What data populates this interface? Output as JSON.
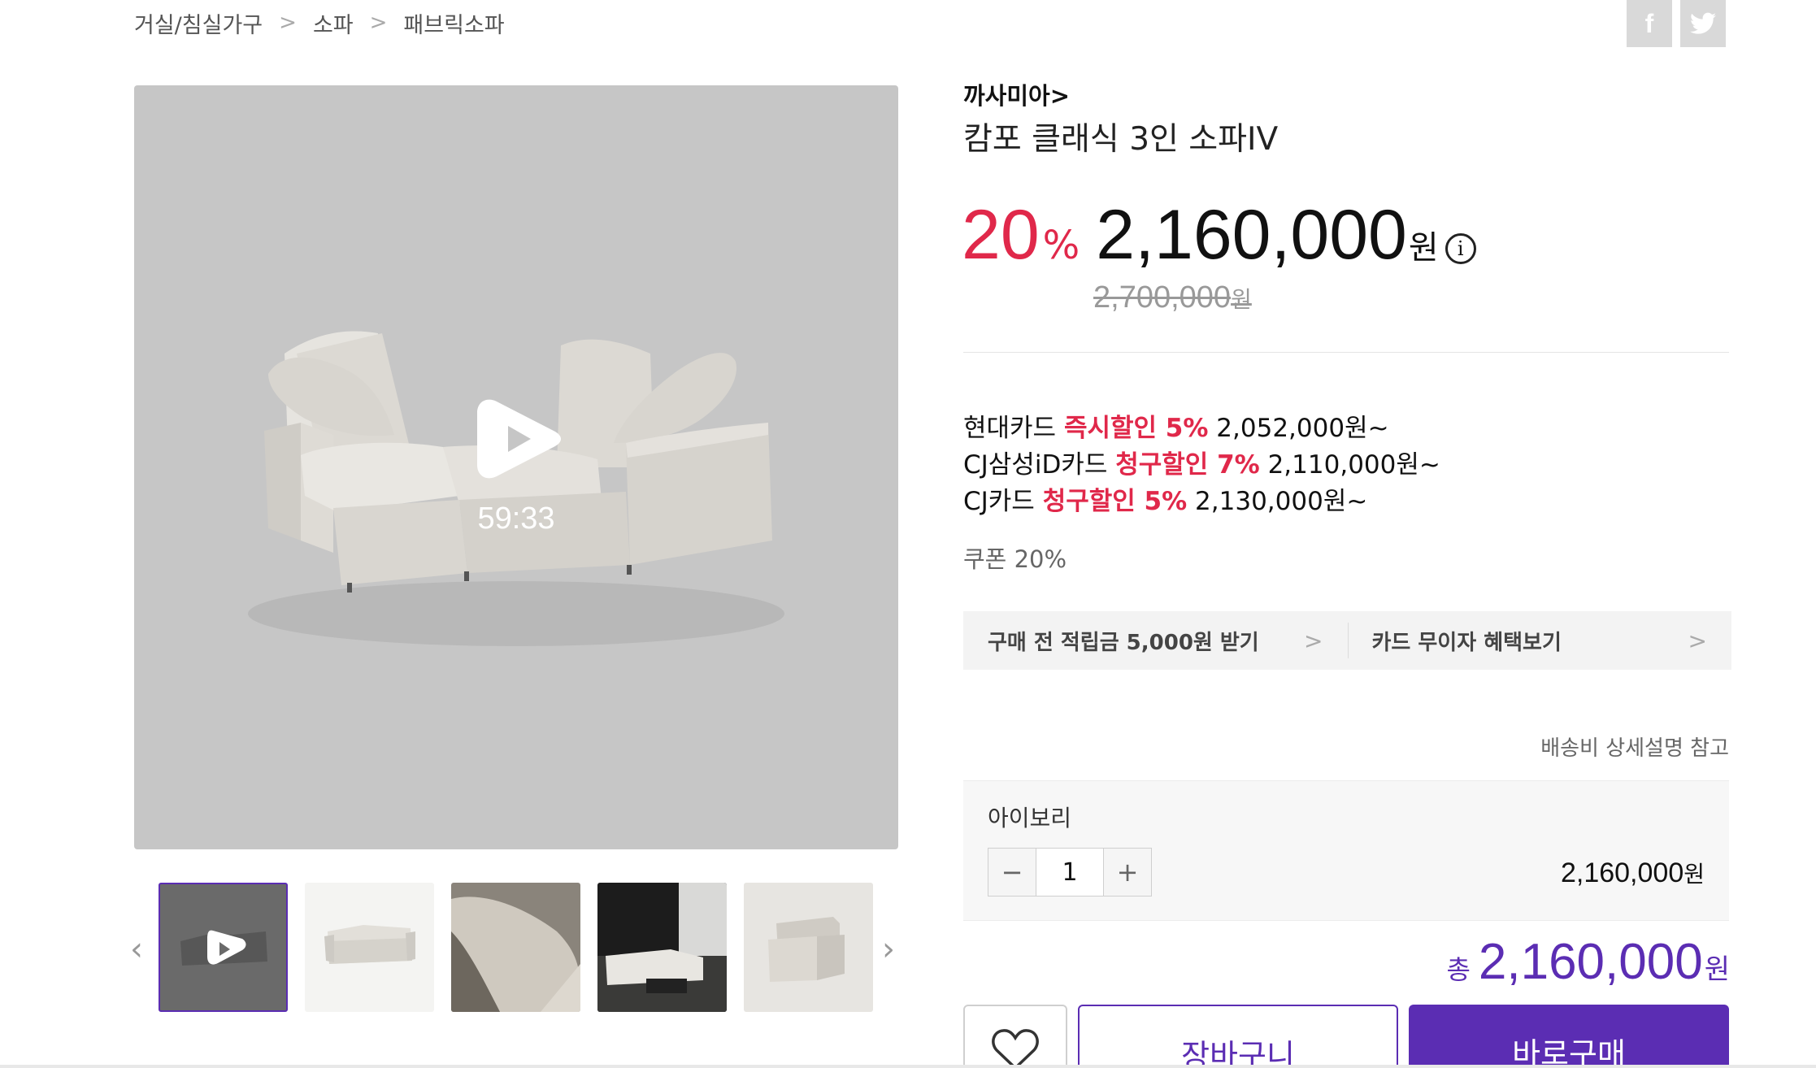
{
  "breadcrumb": {
    "items": [
      "거실/침실가구",
      "소파",
      "패브릭소파"
    ],
    "separator": ">"
  },
  "share": {
    "facebook": "f",
    "twitter": "twitter-bird"
  },
  "media": {
    "duration": "59:33",
    "thumbnails": [
      {
        "label": "video-thumbnail",
        "active": true
      },
      {
        "label": "sofa-front-thumbnail",
        "active": false
      },
      {
        "label": "sofa-cushion-closeup-thumbnail",
        "active": false
      },
      {
        "label": "living-room-thumbnail",
        "active": false
      },
      {
        "label": "sofa-module-thumbnail",
        "active": false
      }
    ]
  },
  "product": {
    "brand": "까사미아>",
    "title": "캄포 클래식 3인 소파IV",
    "discount": "20",
    "discount_unit": "%",
    "price": "2,160,000",
    "price_unit": "원",
    "info_icon": "i",
    "original_price": "2,700,000",
    "original_price_unit": "원"
  },
  "card_offers": [
    {
      "card": "현대카드 ",
      "benefit": "즉시할인 5%",
      "price": " 2,052,000원~"
    },
    {
      "card": "CJ삼성iD카드 ",
      "benefit": "청구할인 7%",
      "price": " 2,110,000원~"
    },
    {
      "card": "CJ카드 ",
      "benefit": "청구할인 5%",
      "price": " 2,130,000원~"
    }
  ],
  "coupon": "쿠폰 20%",
  "benefits": {
    "points": "구매 전 적립금 5,000원 받기",
    "card_interest_free": "카드 무이자 혜택보기",
    "chevron": ">"
  },
  "shipping_note": "배송비 상세설명 참고",
  "option": {
    "name": "아이보리",
    "minus": "−",
    "quantity": "1",
    "plus": "+",
    "price": "2,160,000",
    "price_unit": "원"
  },
  "total": {
    "label": "총",
    "amount": "2,160,000",
    "unit": "원"
  },
  "actions": {
    "cart": "장바구니",
    "buy": "바로구매"
  },
  "colors": {
    "accent": "#5b2db3",
    "discount": "#e0284a",
    "image_bg": "#c6c6c6"
  }
}
